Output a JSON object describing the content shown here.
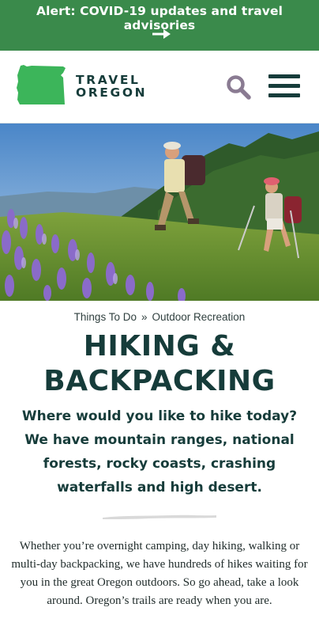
{
  "alert": {
    "text": "Alert: COVID-19 updates and travel advisories",
    "arrow_icon": "right-arrow-icon",
    "background": "#3a8a4b"
  },
  "header": {
    "logo_line1": "TRAVEL",
    "logo_line2": "OREGON",
    "logo_icon": "oregon-map-icon",
    "logo_color": "#3cb55a",
    "search_icon": "search-icon",
    "menu_icon": "hamburger-menu-icon",
    "search_color": "#8a7b92",
    "brand_dark": "#163c3a"
  },
  "hero": {
    "image_name": "hero-image"
  },
  "breadcrumb": {
    "items": [
      "Things To Do",
      "Outdoor Recreation"
    ],
    "separator": "»"
  },
  "title": {
    "line1": "HIKING &",
    "line2": "BACKPACKING"
  },
  "subtitle": "Where would you like to hike today? We have mountain ranges, national forests, rocky coasts, crashing waterfalls and high desert.",
  "body": "Whether you’re overnight camping, day hiking, walking or multi-day backpacking, we have hundreds of hikes waiting for you in the great Oregon outdoors. So go ahead, take a look around. Oregon’s trails are ready when you are."
}
